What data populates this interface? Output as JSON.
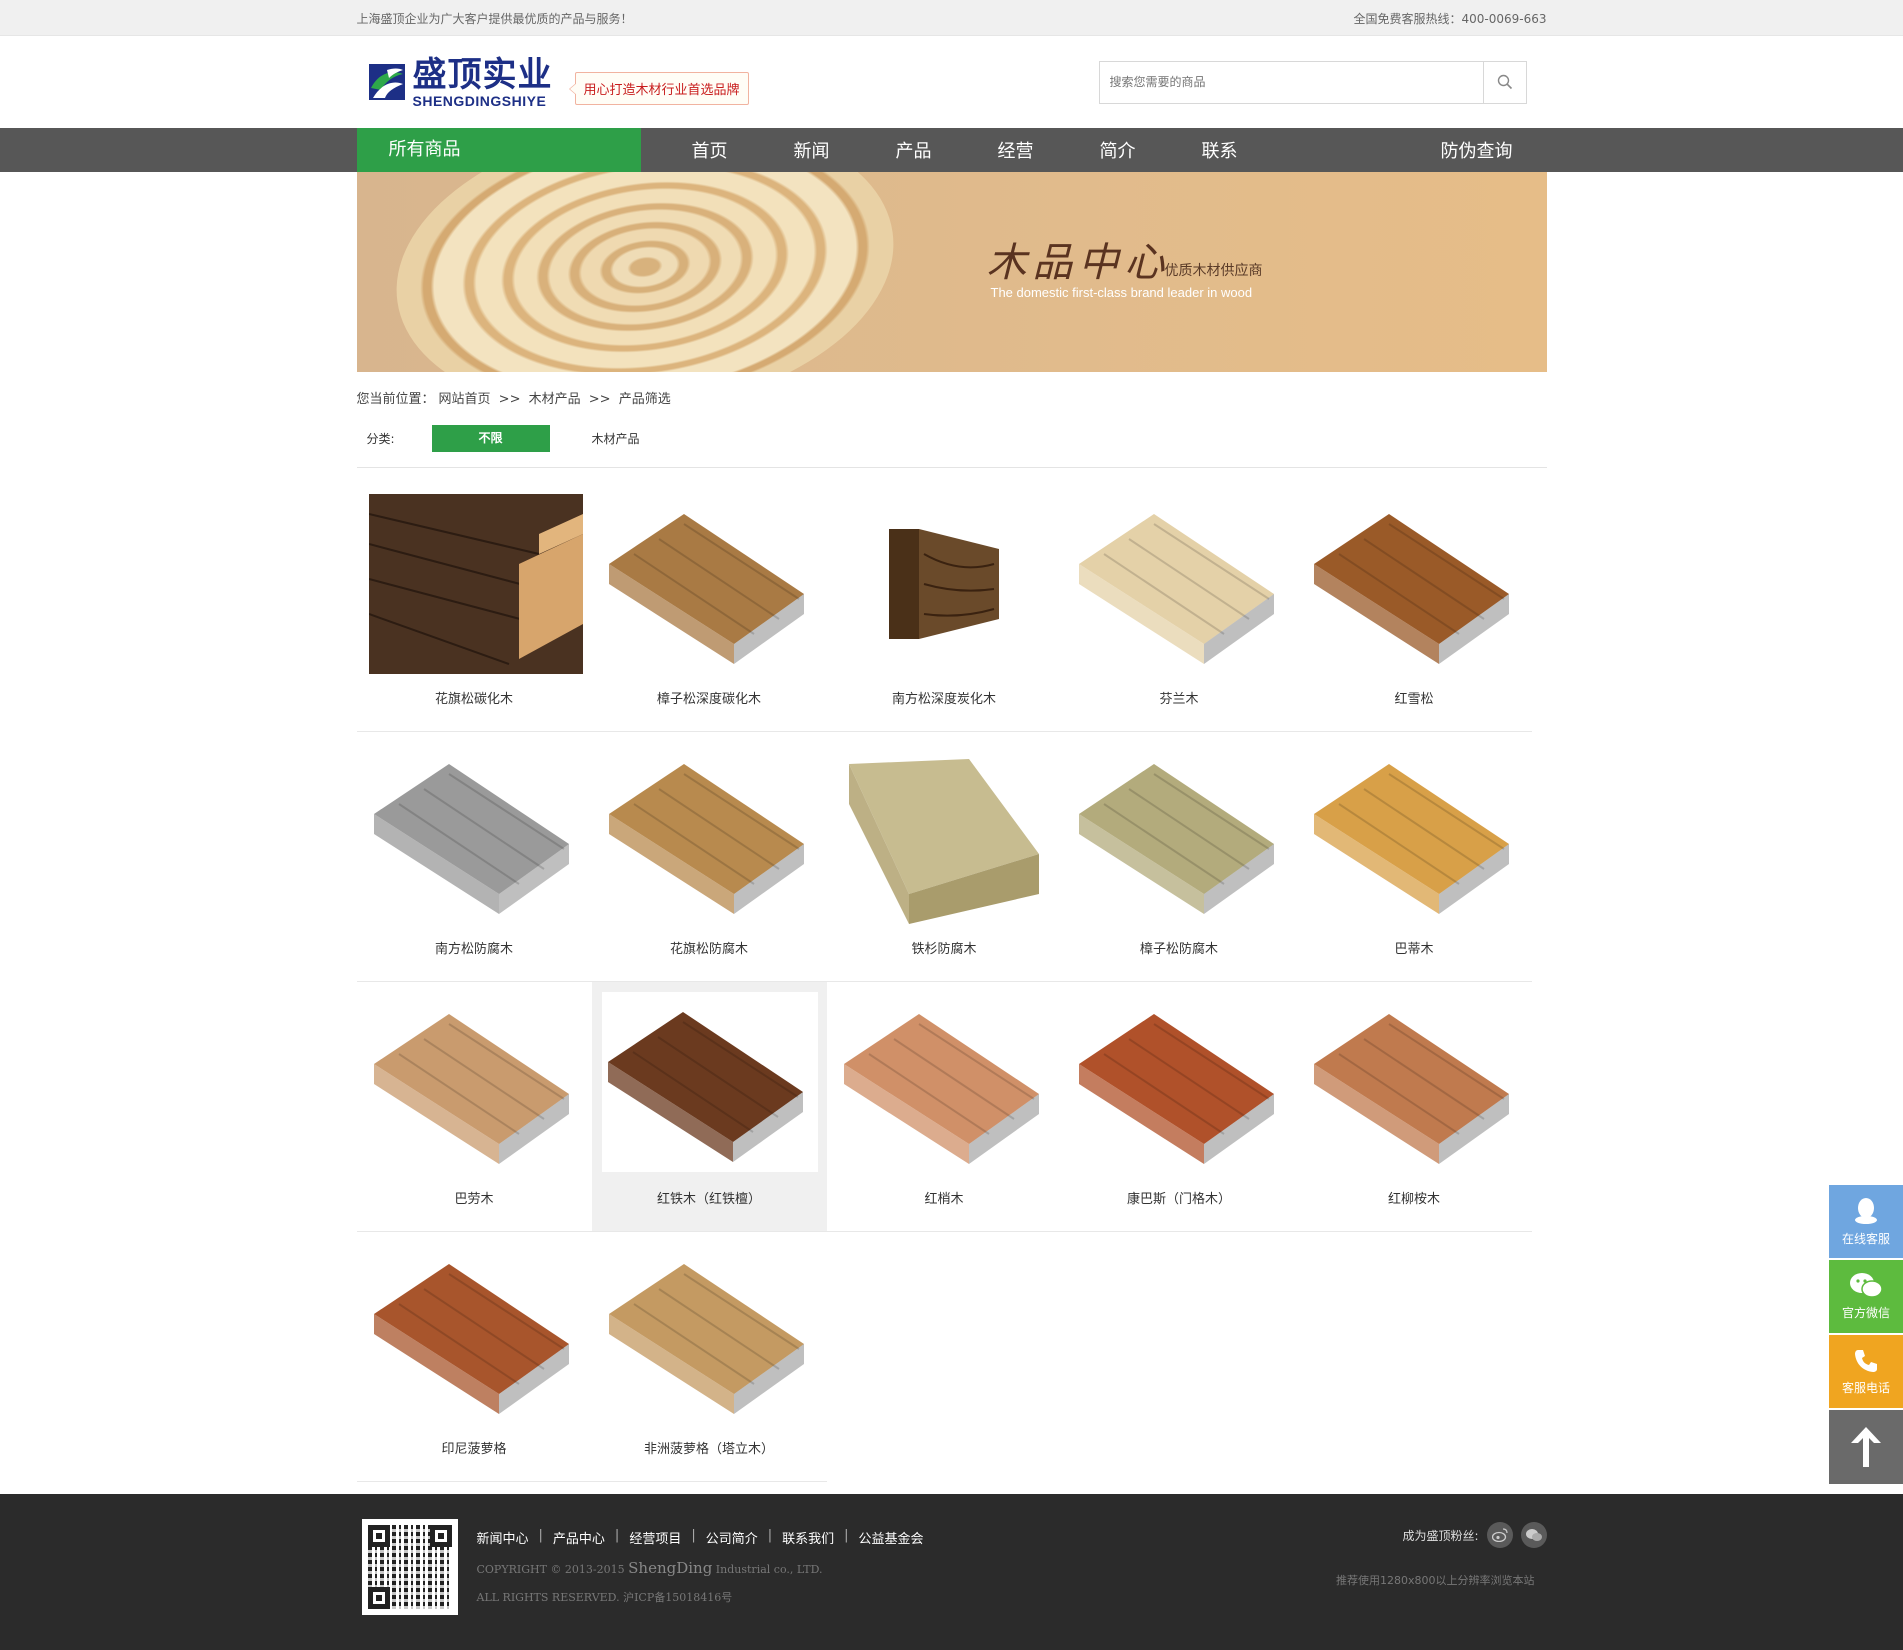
{
  "topbar": {
    "left": "上海盛顶企业为广大客户提供最优质的产品与服务！",
    "right": "全国免费客服热线：400-0069-663"
  },
  "header": {
    "logo_cn": "盛顶实业",
    "logo_en": "SHENGDINGSHIYE",
    "slogan": "用心打造木材行业首选品牌",
    "search_placeholder": "搜索您需要的商品"
  },
  "nav": {
    "all": "所有商品",
    "items": [
      "首页",
      "新闻",
      "产品",
      "经营",
      "简介",
      "联系"
    ],
    "right": "防伪查询"
  },
  "banner": {
    "title": "木品中心",
    "subtitle": "优质木材供应商",
    "english": "The domestic first-class brand leader in wood"
  },
  "breadcrumb": {
    "prefix": "您当前位置：",
    "home": "网站首页",
    "sep": ">>",
    "cat": "木材产品",
    "current": "产品筛选"
  },
  "filter": {
    "label": "分类:",
    "active": "不限",
    "option": "木材产品"
  },
  "products": [
    {
      "name": "花旗松碳化木",
      "color": "#4a3221"
    },
    {
      "name": "樟子松深度碳化木",
      "color": "#a97a44"
    },
    {
      "name": "南方松深度炭化木",
      "color": "#6a4a2a"
    },
    {
      "name": "芬兰木",
      "color": "#e4d1a8"
    },
    {
      "name": "红雪松",
      "color": "#9a5a28"
    },
    {
      "name": "南方松防腐木",
      "color": "#9a9a9a"
    },
    {
      "name": "花旗松防腐木",
      "color": "#b88a4e"
    },
    {
      "name": "铁杉防腐木",
      "color": "#c7bc90"
    },
    {
      "name": "樟子松防腐木",
      "color": "#b3ab7c"
    },
    {
      "name": "巴蒂木",
      "color": "#d8a048"
    },
    {
      "name": "巴劳木",
      "color": "#c99b6e"
    },
    {
      "name": "红铁木（红铁檀）",
      "color": "#6b3a1f"
    },
    {
      "name": "红梢木",
      "color": "#d09068"
    },
    {
      "name": "康巴斯（门格木）",
      "color": "#b0512a"
    },
    {
      "name": "红柳桉木",
      "color": "#c07a4e"
    },
    {
      "name": "印尼菠萝格",
      "color": "#a8552c"
    },
    {
      "name": "非洲菠萝格（塔立木）",
      "color": "#c49a62"
    }
  ],
  "footer": {
    "links": [
      "新闻中心",
      "产品中心",
      "经营项目",
      "公司简介",
      "联系我们",
      "公益基金会"
    ],
    "link_sep": "|",
    "copy_pre": "COPYRIGHT © 2013-2015 ",
    "copy_brand": "ShengDing",
    "copy_post": " Industrial co., LTD.",
    "rights": "ALL RIGHTS RESERVED. 沪ICP备15018416号",
    "fans": "成为盛顶粉丝:",
    "recommend": "推荐使用1280x800以上分辨率浏览本站"
  },
  "side": {
    "qq": "在线客服",
    "wechat": "官方微信",
    "phone": "客服电话",
    "qq_color": "#6fa6e0",
    "wechat_color": "#5dbb3e",
    "phone_color": "#f0a520",
    "top_color": "#6a6a6a"
  }
}
